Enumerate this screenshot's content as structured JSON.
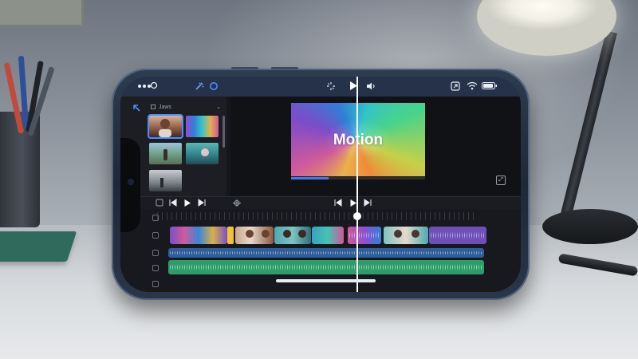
{
  "scene": {
    "description_items": [
      "desk-lamp",
      "pencil-cup",
      "notebook",
      "screwdriver",
      "picture-frame"
    ]
  },
  "app": {
    "top_bar": {
      "left_icons": [
        "more-dots-icon",
        "magic-wand-icon",
        "circle-icon"
      ],
      "center_icons": [
        "loading-spinner-icon",
        "play-icon",
        "audio-out-icon"
      ],
      "right_icons": [
        "screen-mirror-icon",
        "wifi-icon",
        "battery-icon"
      ]
    },
    "browser": {
      "header_label": "Jaws",
      "thumbnails": [
        {
          "name": "woman-portrait",
          "selected": true
        },
        {
          "name": "rainbow-gradient",
          "selected": false
        },
        {
          "name": "outdoor-person",
          "selected": false
        },
        {
          "name": "teal-scene",
          "selected": false
        },
        {
          "name": "landscape-dark",
          "selected": false
        }
      ]
    },
    "viewer": {
      "title_text": "Motion",
      "progress": 0.28
    },
    "transport": {
      "buttons": [
        "skip-back-icon",
        "play-icon",
        "skip-forward-icon"
      ]
    },
    "timeline": {
      "playhead_fraction": 0.56
    }
  }
}
